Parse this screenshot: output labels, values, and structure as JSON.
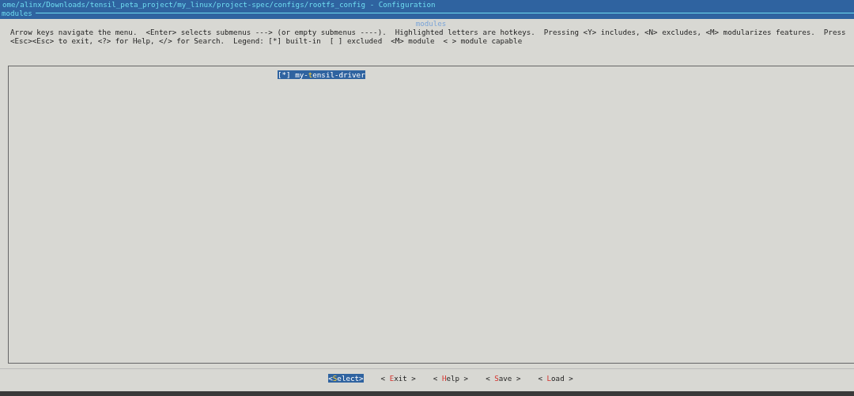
{
  "window": {
    "title": "ome/alinx/Downloads/tensil_peta_project/my_linux/project-spec/configs/rootfs_config - Configuration",
    "breadcrumb": "modules"
  },
  "dialog": {
    "title": "modules",
    "help": [
      "Arrow keys navigate the menu.  <Enter> selects submenus ---> (or empty submenus ----).  Highlighted letters are hotkeys.  Pressing <Y> includes, <N> excludes, <M> modularizes features.  Press",
      "<Esc><Esc> to exit, <?> for Help, </> for Search.  Legend: [*] built-in  [ ] excluded  <M> module  < > module capable"
    ],
    "items": [
      {
        "box": "[*]",
        "before": " my-",
        "hotkey": "t",
        "after": "ensil-driver",
        "selected": true
      }
    ],
    "buttons": [
      {
        "before": "<",
        "hotkey": "S",
        "after": "elect>",
        "selected": true
      },
      {
        "before": "< ",
        "hotkey": "E",
        "after": "xit >",
        "selected": false
      },
      {
        "before": "< ",
        "hotkey": "H",
        "after": "elp >",
        "selected": false
      },
      {
        "before": "< ",
        "hotkey": "S",
        "after": "ave >",
        "selected": false
      },
      {
        "before": "< ",
        "hotkey": "L",
        "after": "oad >",
        "selected": false
      }
    ]
  }
}
